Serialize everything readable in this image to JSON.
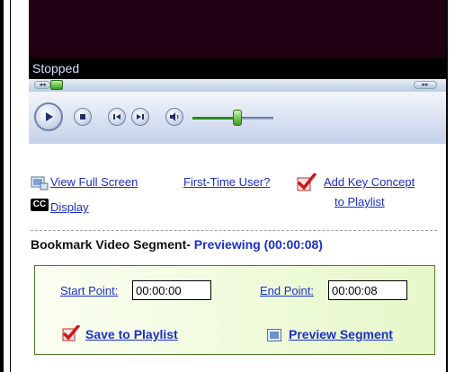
{
  "player": {
    "status": "Stopped",
    "seek_left_glyph": "◂◂",
    "seek_right_glyph": "▸▸",
    "icons": [
      "play-icon",
      "stop-icon",
      "previous-icon",
      "next-icon",
      "mute-icon"
    ],
    "volume_fraction": 0.55
  },
  "links": {
    "view_full_screen": "View Full Screen",
    "first_time_user": "First-Time User?",
    "add_key_concept_line1": "Add Key Concept",
    "add_key_concept_line2": "to Playlist",
    "cc_icon_text": "CC",
    "display": "Display"
  },
  "bookmark": {
    "heading": "Bookmark Video Segment-",
    "status": "Previewing (00:00:08)",
    "start_label": "Start Point:",
    "start_value": "00:00:00",
    "end_label": "End Point:",
    "end_value": "00:00:08",
    "save_label": "Save to Playlist",
    "preview_label": "Preview Segment"
  },
  "colors": {
    "link": "#1b2fc7",
    "video_bg": "#200012",
    "panel_border": "#4e7a2e"
  }
}
